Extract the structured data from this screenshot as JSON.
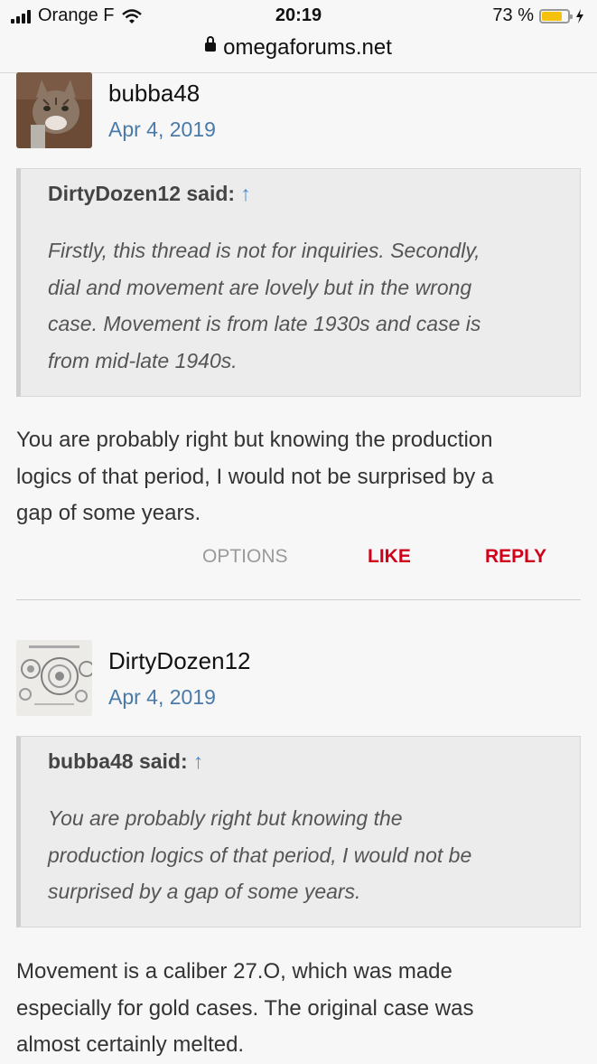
{
  "status_bar": {
    "carrier": "Orange F",
    "time": "20:19",
    "battery": "73 %"
  },
  "browser": {
    "url": "omegaforums.net"
  },
  "posts": [
    {
      "author": "bubba48",
      "date": "Apr 4, 2019",
      "quote": {
        "header": "DirtyDozen12 said:",
        "arrow": "↑",
        "lines": [
          "Firstly, this thread is not for inquiries. Secondly,",
          "dial and movement are lovely but in the wrong",
          "case. Movement is from late 1930s and case is",
          "from mid-late 1940s."
        ]
      },
      "message": [
        "You are probably right but knowing the production",
        "logics of that period, I would not be surprised by a",
        "gap of some years."
      ],
      "actions": {
        "options": "OPTIONS",
        "like": "LIKE",
        "reply": "REPLY"
      }
    },
    {
      "author": "DirtyDozen12",
      "date": "Apr 4, 2019",
      "quote": {
        "header": "bubba48 said:",
        "arrow": "↑",
        "lines": [
          "You are probably right but knowing the",
          "production logics of that period, I would not be",
          "surprised by a gap of some years."
        ]
      },
      "message": [
        "Movement is a caliber 27.O, which was made",
        "especially for gold cases. The original case was",
        "almost certainly melted."
      ]
    }
  ]
}
